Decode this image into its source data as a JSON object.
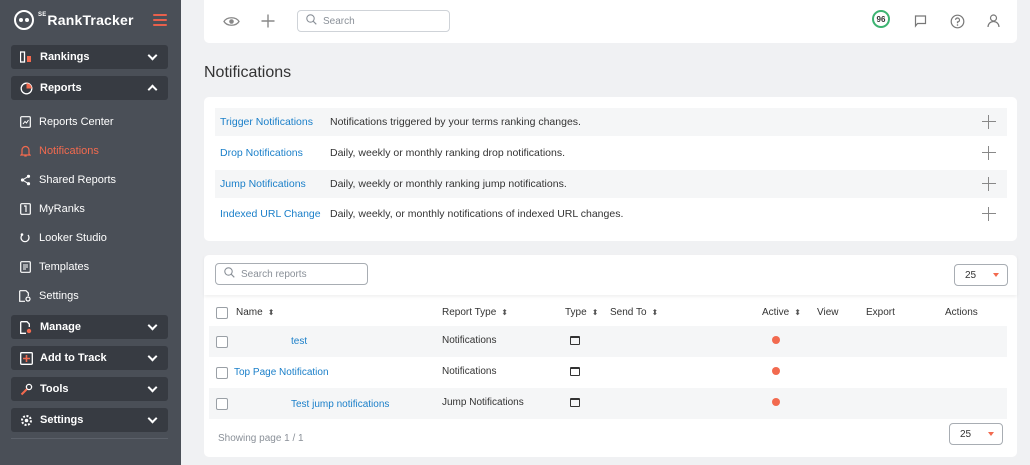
{
  "app": {
    "logo_text": "RankTracker",
    "logo_prefix": "SE"
  },
  "sidebar": {
    "groups": [
      {
        "label": "Rankings",
        "icon": "bar-chart-icon"
      },
      {
        "label": "Reports",
        "icon": "pie-chart-icon"
      },
      {
        "label": "Manage",
        "icon": "manage-icon"
      },
      {
        "label": "Add to Track",
        "icon": "add-box-icon"
      },
      {
        "label": "Tools",
        "icon": "tools-icon"
      },
      {
        "label": "Settings",
        "icon": "gear-icon"
      }
    ],
    "reports_items": [
      {
        "label": "Reports Center",
        "icon": "report-doc-icon"
      },
      {
        "label": "Notifications",
        "icon": "bell-icon"
      },
      {
        "label": "Shared Reports",
        "icon": "share-icon"
      },
      {
        "label": "MyRanks",
        "icon": "myranks-icon"
      },
      {
        "label": "Looker Studio",
        "icon": "looker-icon"
      },
      {
        "label": "Templates",
        "icon": "template-icon"
      },
      {
        "label": "Settings",
        "icon": "settings-doc-icon"
      }
    ]
  },
  "topbar": {
    "search_placeholder": "Search",
    "score": "96"
  },
  "page": {
    "title": "Notifications"
  },
  "notifications": [
    {
      "name": "Trigger Notifications",
      "description": "Notifications triggered by your terms ranking changes."
    },
    {
      "name": "Drop Notifications",
      "description": "Daily, weekly or monthly ranking drop notifications."
    },
    {
      "name": "Jump Notifications",
      "description": "Daily, weekly or monthly ranking jump notifications."
    },
    {
      "name": "Indexed URL Change",
      "description": "Daily, weekly, or monthly notifications of indexed URL changes."
    }
  ],
  "reports": {
    "search_placeholder": "Search reports",
    "per_page": "25",
    "columns": {
      "name": "Name",
      "report_type": "Report Type",
      "type": "Type",
      "send_to": "Send To",
      "active": "Active",
      "view": "View",
      "export": "Export",
      "actions": "Actions"
    },
    "rows": [
      {
        "name": "test",
        "report_type": "Notifications"
      },
      {
        "name": "Top Page Notification",
        "report_type": "Notifications"
      },
      {
        "name": "Test jump notifications",
        "report_type": "Jump Notifications"
      }
    ],
    "footer": "Showing page 1 / 1",
    "accent_color": "#f26a4f",
    "link_color": "#1a7fc9"
  }
}
